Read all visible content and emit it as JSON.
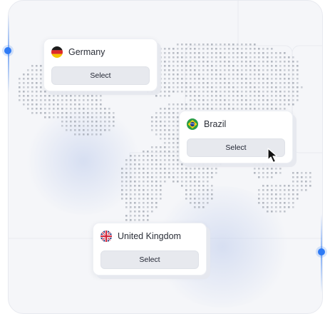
{
  "cards": [
    {
      "country": "Germany",
      "flag_icon": "germany-flag-icon",
      "button_label": "Select"
    },
    {
      "country": "Brazil",
      "flag_icon": "brazil-flag-icon",
      "button_label": "Select"
    },
    {
      "country": "United Kingdom",
      "flag_icon": "uk-flag-icon",
      "button_label": "Select"
    }
  ],
  "colors": {
    "accent": "#2f7bf5",
    "background": "#f5f6f9",
    "button": "#e7e9ee",
    "map_dots": "#9aa0aa"
  },
  "icons": [
    "mouse-cursor-icon"
  ]
}
